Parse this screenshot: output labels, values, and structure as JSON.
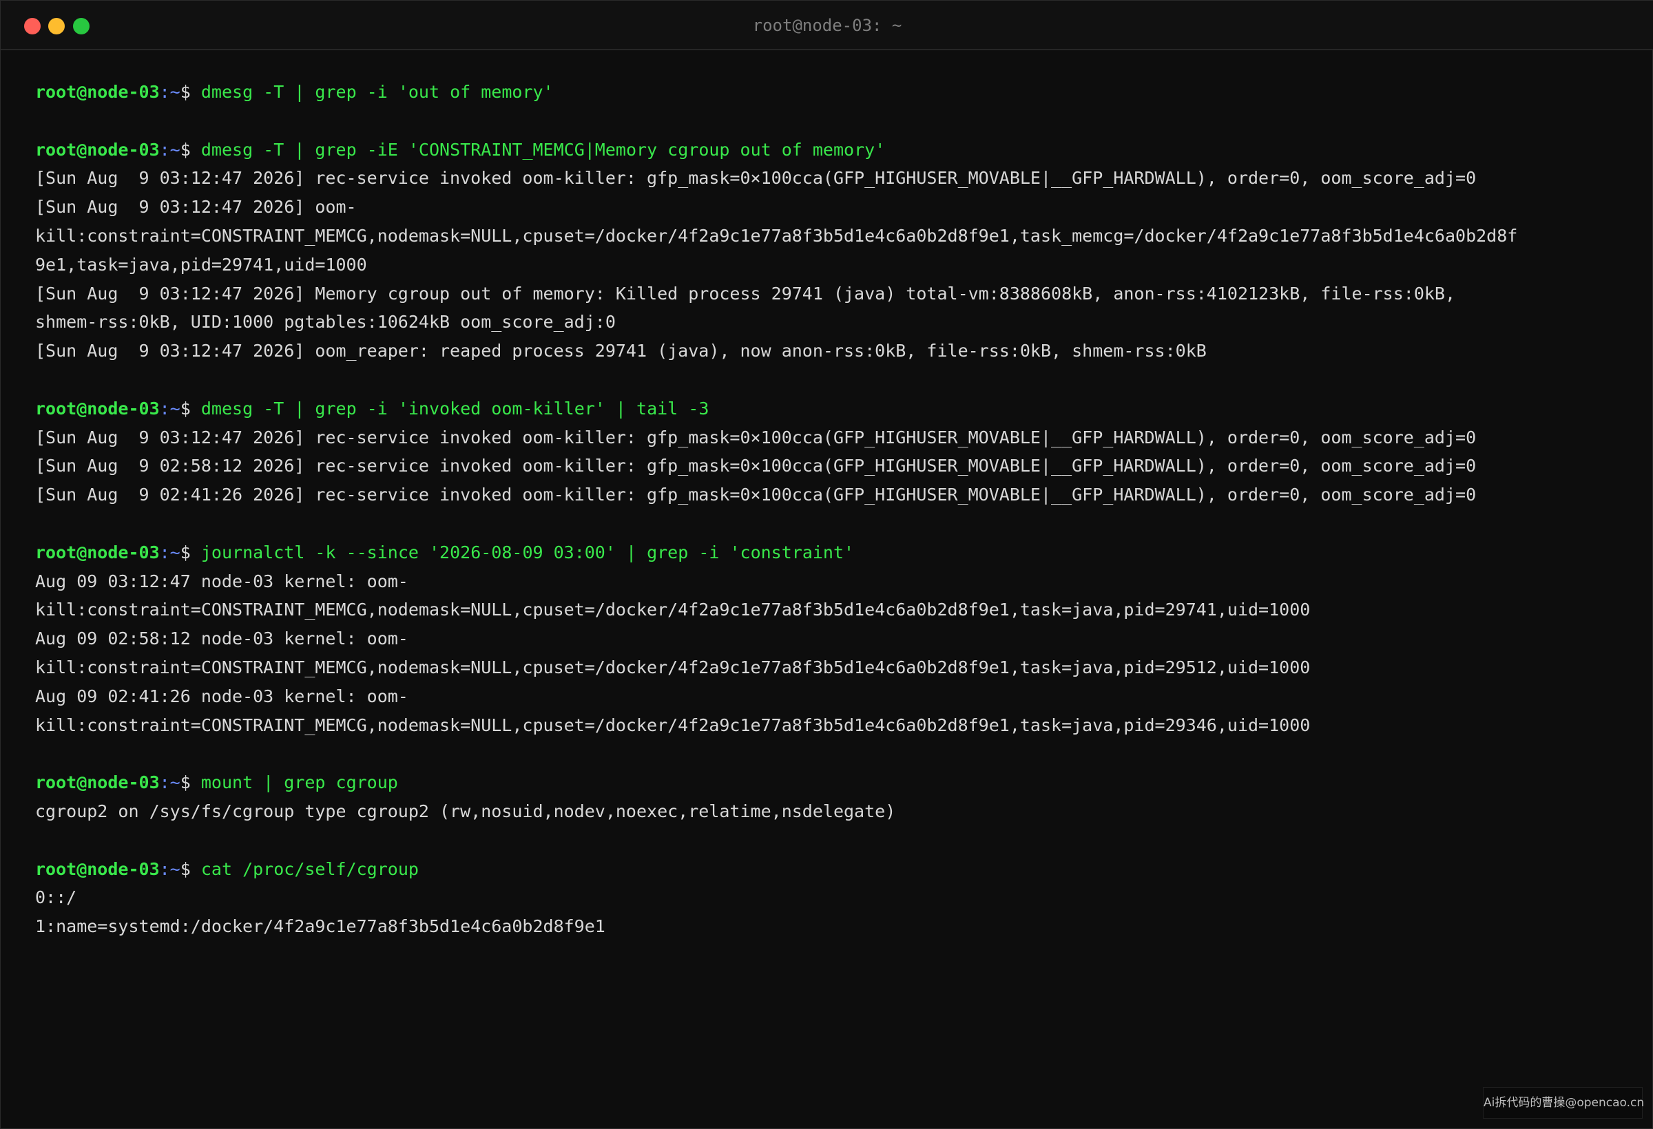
{
  "window": {
    "title": "root@node-03: ~"
  },
  "prompt": {
    "user_host": "root@node-03",
    "path": ":~",
    "symbol": "$"
  },
  "commands": [
    {
      "cmd": "dmesg -T | grep -i 'out of memory'",
      "output": []
    },
    {
      "cmd": "dmesg -T | grep -iE 'CONSTRAINT_MEMCG|Memory cgroup out of memory'",
      "output": [
        "[Sun Aug  9 03:12:47 2026] rec-service invoked oom-killer: gfp_mask=0×100cca(GFP_HIGHUSER_MOVABLE|__GFP_HARDWALL), order=0, oom_score_adj=0",
        "[Sun Aug  9 03:12:47 2026] oom-",
        "kill:constraint=CONSTRAINT_MEMCG,nodemask=NULL,cpuset=/docker/4f2a9c1e77a8f3b5d1e4c6a0b2d8f9e1,task_memcg=/docker/4f2a9c1e77a8f3b5d1e4c6a0b2d8f",
        "9e1,task=java,pid=29741,uid=1000",
        "[Sun Aug  9 03:12:47 2026] Memory cgroup out of memory: Killed process 29741 (java) total-vm:8388608kB, anon-rss:4102123kB, file-rss:0kB,",
        "shmem-rss:0kB, UID:1000 pgtables:10624kB oom_score_adj:0",
        "[Sun Aug  9 03:12:47 2026] oom_reaper: reaped process 29741 (java), now anon-rss:0kB, file-rss:0kB, shmem-rss:0kB"
      ]
    },
    {
      "cmd": "dmesg -T | grep -i 'invoked oom-killer' | tail -3",
      "output": [
        "[Sun Aug  9 03:12:47 2026] rec-service invoked oom-killer: gfp_mask=0×100cca(GFP_HIGHUSER_MOVABLE|__GFP_HARDWALL), order=0, oom_score_adj=0",
        "[Sun Aug  9 02:58:12 2026] rec-service invoked oom-killer: gfp_mask=0×100cca(GFP_HIGHUSER_MOVABLE|__GFP_HARDWALL), order=0, oom_score_adj=0",
        "[Sun Aug  9 02:41:26 2026] rec-service invoked oom-killer: gfp_mask=0×100cca(GFP_HIGHUSER_MOVABLE|__GFP_HARDWALL), order=0, oom_score_adj=0"
      ]
    },
    {
      "cmd": "journalctl -k --since '2026-08-09 03:00' | grep -i 'constraint'",
      "output": [
        "Aug 09 03:12:47 node-03 kernel: oom-",
        "kill:constraint=CONSTRAINT_MEMCG,nodemask=NULL,cpuset=/docker/4f2a9c1e77a8f3b5d1e4c6a0b2d8f9e1,task=java,pid=29741,uid=1000",
        "Aug 09 02:58:12 node-03 kernel: oom-",
        "kill:constraint=CONSTRAINT_MEMCG,nodemask=NULL,cpuset=/docker/4f2a9c1e77a8f3b5d1e4c6a0b2d8f9e1,task=java,pid=29512,uid=1000",
        "Aug 09 02:41:26 node-03 kernel: oom-",
        "kill:constraint=CONSTRAINT_MEMCG,nodemask=NULL,cpuset=/docker/4f2a9c1e77a8f3b5d1e4c6a0b2d8f9e1,task=java,pid=29346,uid=1000"
      ]
    },
    {
      "cmd": "mount | grep cgroup",
      "output": [
        "cgroup2 on /sys/fs/cgroup type cgroup2 (rw,nosuid,nodev,noexec,relatime,nsdelegate)"
      ]
    },
    {
      "cmd": "cat /proc/self/cgroup",
      "output": [
        "0::/",
        "1:name=systemd:/docker/4f2a9c1e77a8f3b5d1e4c6a0b2d8f9e1"
      ]
    }
  ],
  "watermark": {
    "text": "Ai拆代码的曹操@opencao.cn"
  },
  "colors": {
    "background": "#0d0d0d",
    "prompt_green": "#39e84b",
    "path_blue": "#6b8cff",
    "output_text": "#d8d8d8",
    "close": "#ff5f57",
    "minimize": "#febc2e",
    "maximize": "#28c840"
  }
}
